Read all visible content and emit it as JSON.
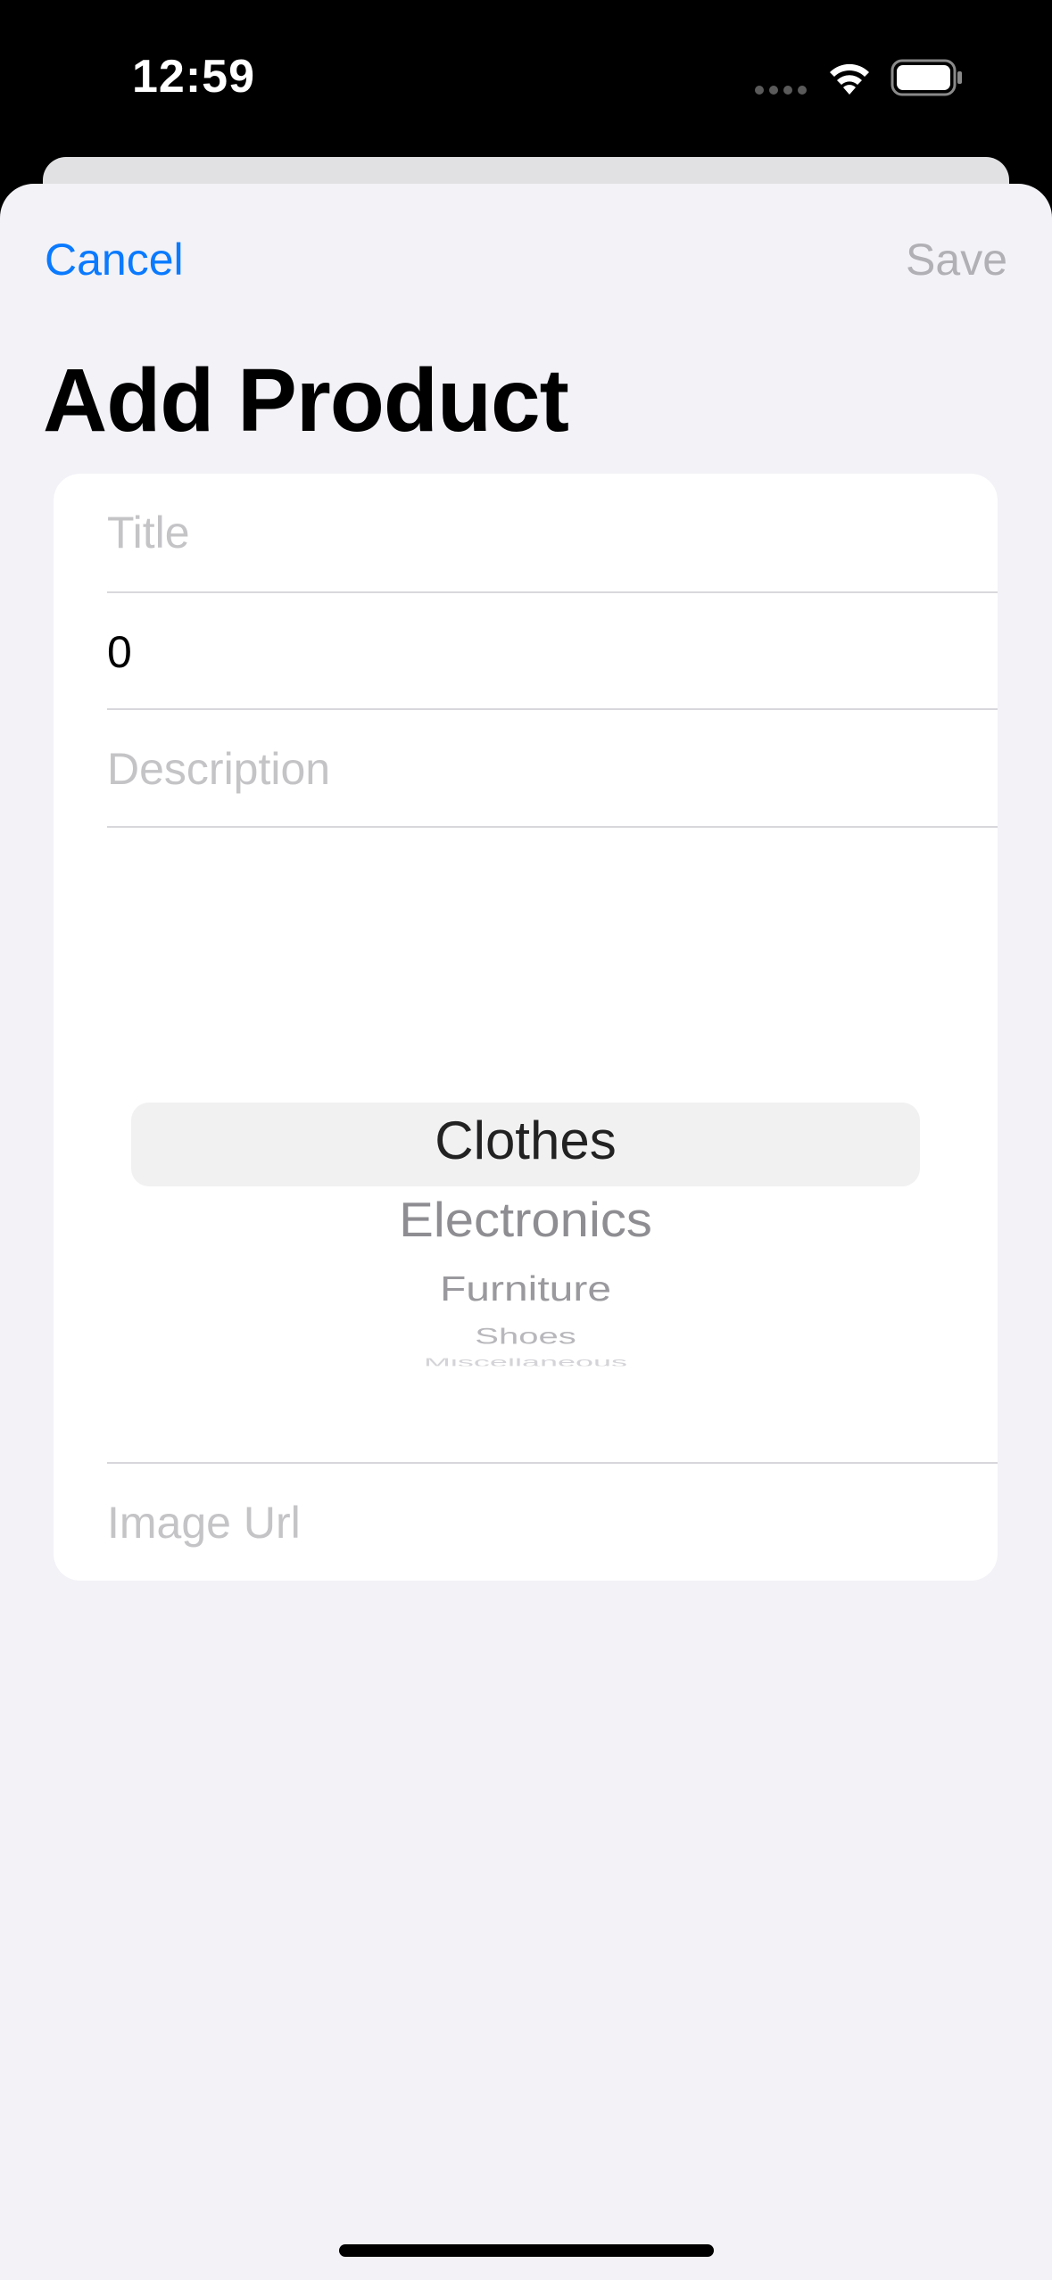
{
  "status_bar": {
    "time": "12:59",
    "icons": [
      "signal-icon",
      "wifi-icon",
      "battery-icon"
    ]
  },
  "nav": {
    "cancel_label": "Cancel",
    "save_label": "Save",
    "title": "Add Product",
    "accent_color": "#0a7aff",
    "disabled_color": "#b0b0b5"
  },
  "form": {
    "title_field": {
      "value": "",
      "placeholder": "Title"
    },
    "price_field": {
      "value": "0"
    },
    "description_field": {
      "value": "",
      "placeholder": "Description"
    },
    "category_picker": {
      "selected": "Clothes",
      "options": [
        "Clothes",
        "Electronics",
        "Furniture",
        "Shoes",
        "Miscellaneous"
      ]
    },
    "image_url_field": {
      "value": "",
      "placeholder": "Image Url"
    }
  }
}
